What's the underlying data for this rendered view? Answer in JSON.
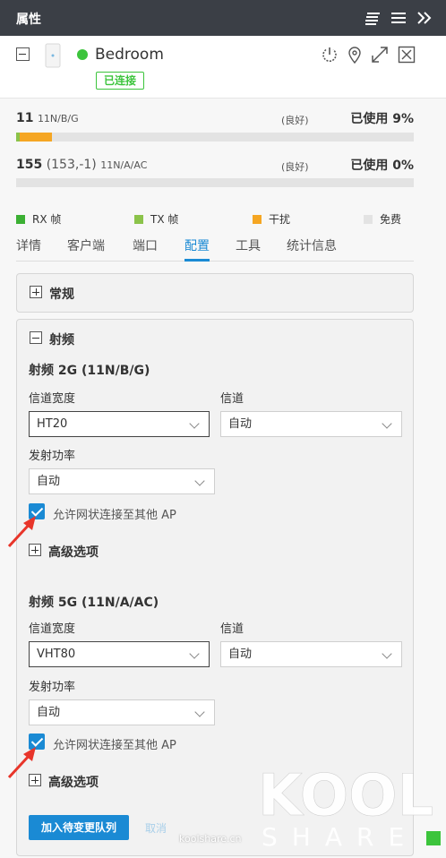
{
  "header": {
    "title": "属性"
  },
  "device": {
    "name": "Bedroom",
    "status": "已连接",
    "status_color": "#3cc43c"
  },
  "radio_stats": [
    {
      "channel": "11",
      "mode": "11N/B/G",
      "quality": "(良好)",
      "usage": "已使用 9%",
      "tx_fraction": 0.01,
      "interference_fraction": 0.08
    },
    {
      "channel": "155",
      "channel_extra": "(153,-1)",
      "mode": "11N/A/AC",
      "quality": "(良好)",
      "usage": "已使用 0%",
      "tx_fraction": 0,
      "interference_fraction": 0
    }
  ],
  "legend": [
    {
      "label": "RX 帧",
      "color": "#3cb034"
    },
    {
      "label": "TX 帧",
      "color": "#8bc34a"
    },
    {
      "label": "干扰",
      "color": "#f5a623"
    },
    {
      "label": "免费",
      "color": "#e3e3e3"
    }
  ],
  "tabs": [
    "详情",
    "客户端",
    "端口",
    "配置",
    "工具",
    "统计信息"
  ],
  "active_tab": "配置",
  "sections": {
    "general": "常规",
    "radio": "射频"
  },
  "radio_2g": {
    "title": "射频 2G (11N/B/G)",
    "width_label": "信道宽度",
    "width_value": "HT20",
    "channel_label": "信道",
    "channel_value": "自动",
    "power_label": "发射功率",
    "power_value": "自动",
    "mesh_label": "允许网状连接至其他 AP",
    "advanced": "高级选项"
  },
  "radio_5g": {
    "title": "射频 5G  (11N/A/AC)",
    "width_label": "信道宽度",
    "width_value": "VHT80",
    "channel_label": "信道",
    "channel_value": "自动",
    "power_label": "发射功率",
    "power_value": "自动",
    "mesh_label": "允许网状连接至其他 AP",
    "advanced": "高级选项"
  },
  "actions": {
    "queue": "加入待变更队列",
    "cancel": "取消"
  },
  "watermark": {
    "big": "KOOL",
    "sub": "SHARE",
    "small": "koolshare.cn"
  },
  "colors": {
    "accent": "#1a8ad4",
    "header_bg": "#3b3f46"
  }
}
